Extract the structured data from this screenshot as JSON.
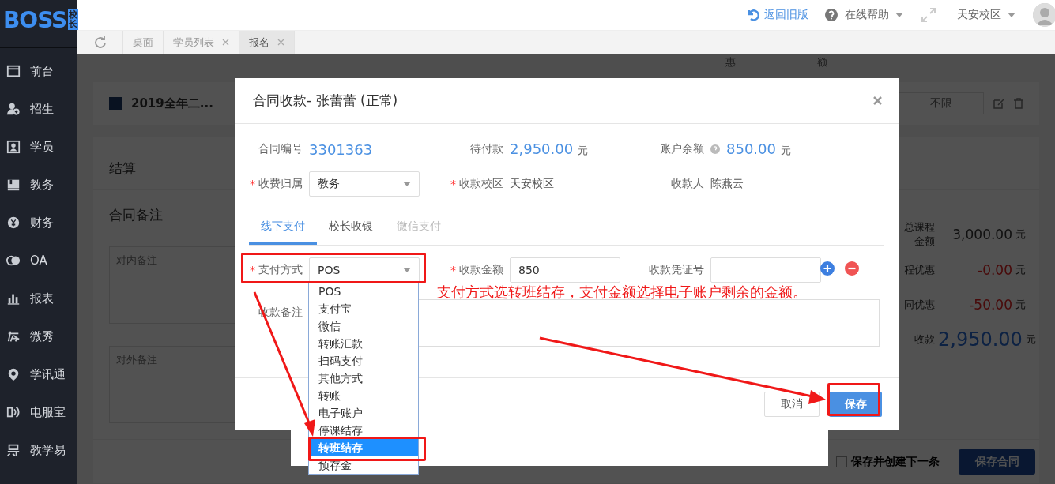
{
  "logo": {
    "text": "BOSS",
    "badge": "校长"
  },
  "header": {
    "back_link": "返回旧版",
    "help_menu": "在线帮助",
    "campus_menu": "天安校区"
  },
  "sidebar": {
    "items": [
      {
        "label": "前台"
      },
      {
        "label": "招生"
      },
      {
        "label": "学员"
      },
      {
        "label": "教务"
      },
      {
        "label": "财务"
      },
      {
        "label": "OA"
      },
      {
        "label": "报表"
      },
      {
        "label": "微秀"
      },
      {
        "label": "学讯通"
      },
      {
        "label": "电服宝"
      },
      {
        "label": "教学易"
      }
    ]
  },
  "tabs": [
    {
      "label": "桌面",
      "closable": false,
      "selected": false
    },
    {
      "label": "学员列表",
      "closable": true,
      "selected": false
    },
    {
      "label": "报名",
      "closable": true,
      "selected": true
    }
  ],
  "background": {
    "column_headers": [
      "惠",
      "额"
    ],
    "class_card": {
      "title": "2019全年二...",
      "limit_button": "不限"
    },
    "settlement_title": "结算",
    "remarks_title": "合同备注",
    "remark_fields": [
      {
        "placeholder": "对内备注"
      },
      {
        "placeholder": "对外备注"
      }
    ],
    "summary": [
      {
        "label": "总课程金额",
        "value": "3,000.00",
        "unit": "元",
        "kind": "normal"
      },
      {
        "label": "程优惠",
        "value": "-0.00",
        "unit": "元",
        "kind": "discount"
      },
      {
        "label": "同优惠",
        "value": "-50.00",
        "unit": "元",
        "kind": "discount"
      },
      {
        "label": "收款",
        "value": "2,950.00",
        "unit": "元",
        "kind": "total"
      }
    ],
    "save_next": {
      "label": "保存并创建下一条",
      "checked": false
    },
    "save_contract_button": "保存合同"
  },
  "modal": {
    "title": "合同收款- 张蕾蕾 (正常)",
    "required_mark": "*",
    "info": [
      {
        "label": "合同编号",
        "value": "3301363",
        "help": false
      },
      {
        "label": "待付款",
        "value": "2,950.00",
        "unit": "元",
        "help": false
      },
      {
        "label": "账户余额",
        "value": "850.00",
        "unit": "元",
        "help": true
      }
    ],
    "fields": [
      {
        "label": "收费归属",
        "required": true,
        "kind": "select",
        "value": "教务"
      },
      {
        "label": "收款校区",
        "required": true,
        "kind": "text",
        "value": "天安校区"
      },
      {
        "label": "收款人",
        "required": false,
        "kind": "text",
        "value": "陈燕云"
      }
    ],
    "pay_tabs": [
      {
        "label": "线下支付",
        "selected": true,
        "disabled": false
      },
      {
        "label": "校长收银",
        "selected": false,
        "disabled": false
      },
      {
        "label": "微信支付",
        "selected": false,
        "disabled": true
      }
    ],
    "payment_fields": [
      {
        "label": "支付方式",
        "required": true,
        "kind": "select",
        "value": "POS"
      },
      {
        "label": "收款金额",
        "required": true,
        "kind": "input",
        "value": "850"
      },
      {
        "label": "收款凭证号",
        "required": false,
        "kind": "input"
      }
    ],
    "remark_label": "收款备注",
    "cancel_button": "取消",
    "save_button": "保存"
  },
  "dropdown": {
    "options": [
      {
        "label": "POS",
        "selected": false
      },
      {
        "label": "支付宝",
        "selected": false
      },
      {
        "label": "微信",
        "selected": false
      },
      {
        "label": "转账汇款",
        "selected": false
      },
      {
        "label": "扫码支付",
        "selected": false
      },
      {
        "label": "其他方式",
        "selected": false
      },
      {
        "label": "转账",
        "selected": false
      },
      {
        "label": "电子账户",
        "selected": false
      },
      {
        "label": "停课结存",
        "selected": false
      },
      {
        "label": "转班结存",
        "selected": true
      },
      {
        "label": "预存金",
        "selected": false
      }
    ]
  },
  "annotation": {
    "text": "支付方式选转班结存，支付金额选择电子账户剩余的金额。"
  }
}
